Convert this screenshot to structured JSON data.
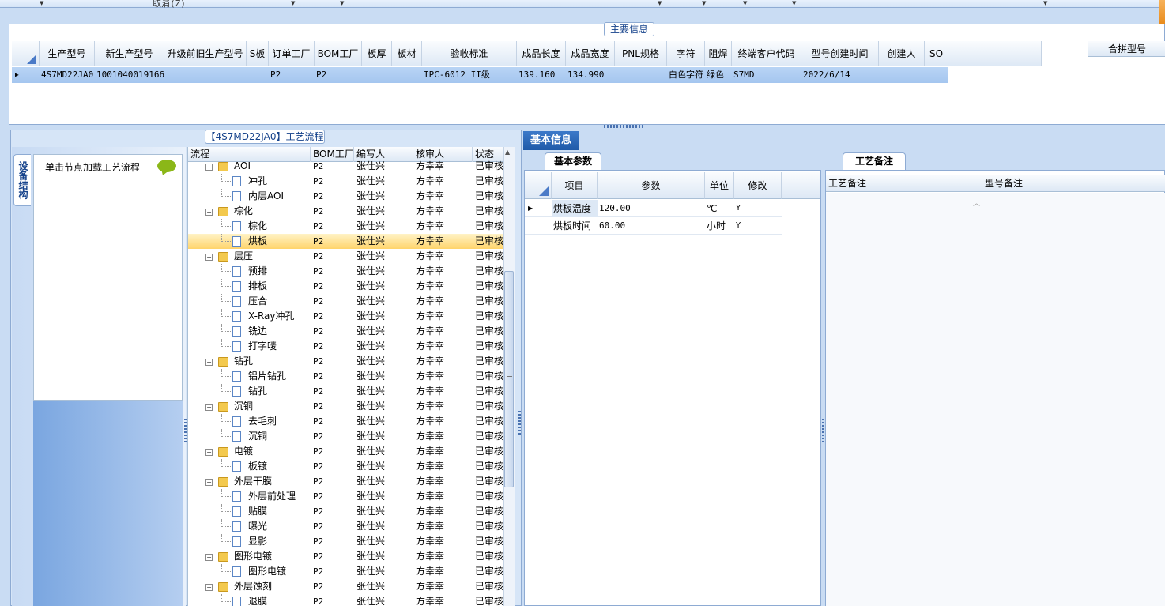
{
  "toolbar": {
    "cancel_label": "取消(Z)"
  },
  "main_info": {
    "title": "主要信息",
    "columns": [
      "生产型号",
      "新生产型号",
      "升级前旧生产型号",
      "S板",
      "订单工厂",
      "BOM工厂",
      "板厚",
      "板材",
      "验收标准",
      "成品长度",
      "成品宽度",
      "PNL规格",
      "字符",
      "阻焊",
      "终端客户代码",
      "型号创建时间",
      "创建人",
      "SO"
    ],
    "row": [
      "4S7MD22JA0",
      "10010400191661",
      "",
      "",
      "P2",
      "P2",
      "",
      "",
      "IPC-6012 II级",
      "139.160",
      "134.990",
      "",
      "白色字符",
      "绿色",
      "S7MD",
      "2022/6/14",
      "",
      ""
    ],
    "merge_header": "合拼型号"
  },
  "flow": {
    "title": "【4S7MD22JA0】工艺流程",
    "vtab_label": "设备结构",
    "load_hint": "单击节点加载工艺流程",
    "columns": [
      "流程",
      "BOM工厂",
      "编写人",
      "核审人",
      "状态"
    ],
    "rows": [
      {
        "name": "AOI",
        "bom": "P2",
        "writer": "张仕兴",
        "reviewer": "方幸幸",
        "status": "已审核",
        "level": 0
      },
      {
        "name": "冲孔",
        "bom": "P2",
        "writer": "张仕兴",
        "reviewer": "方幸幸",
        "status": "已审核",
        "level": 1
      },
      {
        "name": "内层AOI",
        "bom": "P2",
        "writer": "张仕兴",
        "reviewer": "方幸幸",
        "status": "已审核",
        "level": 1
      },
      {
        "name": "棕化",
        "bom": "P2",
        "writer": "张仕兴",
        "reviewer": "方幸幸",
        "status": "已审核",
        "level": 0
      },
      {
        "name": "棕化",
        "bom": "P2",
        "writer": "张仕兴",
        "reviewer": "方幸幸",
        "status": "已审核",
        "level": 1
      },
      {
        "name": "烘板",
        "bom": "P2",
        "writer": "张仕兴",
        "reviewer": "方幸幸",
        "status": "已审核",
        "level": 1,
        "selected": true
      },
      {
        "name": "层压",
        "bom": "P2",
        "writer": "张仕兴",
        "reviewer": "方幸幸",
        "status": "已审核",
        "level": 0
      },
      {
        "name": "预排",
        "bom": "P2",
        "writer": "张仕兴",
        "reviewer": "方幸幸",
        "status": "已审核",
        "level": 1
      },
      {
        "name": "排板",
        "bom": "P2",
        "writer": "张仕兴",
        "reviewer": "方幸幸",
        "status": "已审核",
        "level": 1
      },
      {
        "name": "压合",
        "bom": "P2",
        "writer": "张仕兴",
        "reviewer": "方幸幸",
        "status": "已审核",
        "level": 1
      },
      {
        "name": "X-Ray冲孔",
        "bom": "P2",
        "writer": "张仕兴",
        "reviewer": "方幸幸",
        "status": "已审核",
        "level": 1
      },
      {
        "name": "铣边",
        "bom": "P2",
        "writer": "张仕兴",
        "reviewer": "方幸幸",
        "status": "已审核",
        "level": 1
      },
      {
        "name": "打字唛",
        "bom": "P2",
        "writer": "张仕兴",
        "reviewer": "方幸幸",
        "status": "已审核",
        "level": 1
      },
      {
        "name": "钻孔",
        "bom": "P2",
        "writer": "张仕兴",
        "reviewer": "方幸幸",
        "status": "已审核",
        "level": 0
      },
      {
        "name": "铝片钻孔",
        "bom": "P2",
        "writer": "张仕兴",
        "reviewer": "方幸幸",
        "status": "已审核",
        "level": 1
      },
      {
        "name": "钻孔",
        "bom": "P2",
        "writer": "张仕兴",
        "reviewer": "方幸幸",
        "status": "已审核",
        "level": 1
      },
      {
        "name": "沉铜",
        "bom": "P2",
        "writer": "张仕兴",
        "reviewer": "方幸幸",
        "status": "已审核",
        "level": 0
      },
      {
        "name": "去毛刺",
        "bom": "P2",
        "writer": "张仕兴",
        "reviewer": "方幸幸",
        "status": "已审核",
        "level": 1
      },
      {
        "name": "沉铜",
        "bom": "P2",
        "writer": "张仕兴",
        "reviewer": "方幸幸",
        "status": "已审核",
        "level": 1
      },
      {
        "name": "电镀",
        "bom": "P2",
        "writer": "张仕兴",
        "reviewer": "方幸幸",
        "status": "已审核",
        "level": 0
      },
      {
        "name": "板镀",
        "bom": "P2",
        "writer": "张仕兴",
        "reviewer": "方幸幸",
        "status": "已审核",
        "level": 1
      },
      {
        "name": "外层干膜",
        "bom": "P2",
        "writer": "张仕兴",
        "reviewer": "方幸幸",
        "status": "已审核",
        "level": 0
      },
      {
        "name": "外层前处理",
        "bom": "P2",
        "writer": "张仕兴",
        "reviewer": "方幸幸",
        "status": "已审核",
        "level": 1
      },
      {
        "name": "贴膜",
        "bom": "P2",
        "writer": "张仕兴",
        "reviewer": "方幸幸",
        "status": "已审核",
        "level": 1
      },
      {
        "name": "曝光",
        "bom": "P2",
        "writer": "张仕兴",
        "reviewer": "方幸幸",
        "status": "已审核",
        "level": 1
      },
      {
        "name": "显影",
        "bom": "P2",
        "writer": "张仕兴",
        "reviewer": "方幸幸",
        "status": "已审核",
        "level": 1
      },
      {
        "name": "图形电镀",
        "bom": "P2",
        "writer": "张仕兴",
        "reviewer": "方幸幸",
        "status": "已审核",
        "level": 0
      },
      {
        "name": "图形电镀",
        "bom": "P2",
        "writer": "张仕兴",
        "reviewer": "方幸幸",
        "status": "已审核",
        "level": 1
      },
      {
        "name": "外层蚀刻",
        "bom": "P2",
        "writer": "张仕兴",
        "reviewer": "方幸幸",
        "status": "已审核",
        "level": 0
      },
      {
        "name": "退膜",
        "bom": "P2",
        "writer": "张仕兴",
        "reviewer": "方幸幸",
        "status": "已审核",
        "level": 1
      }
    ]
  },
  "basic_info": {
    "tab_label": "基本信息",
    "params_tab": "基本参数",
    "columns": [
      "项目",
      "参数",
      "单位",
      "修改"
    ],
    "rows": [
      {
        "item": "烘板温度",
        "value": "120.00",
        "unit": "℃",
        "modify": "Y"
      },
      {
        "item": "烘板时间",
        "value": "60.00",
        "unit": "小时",
        "modify": "Y"
      }
    ]
  },
  "notes": {
    "tab_label": "工艺备注",
    "col1": "工艺备注",
    "col2": "型号备注"
  },
  "colors": {
    "selected_row": "#ffd46b",
    "header_blue": "#1f5aa8",
    "title_text": "#15428b"
  }
}
